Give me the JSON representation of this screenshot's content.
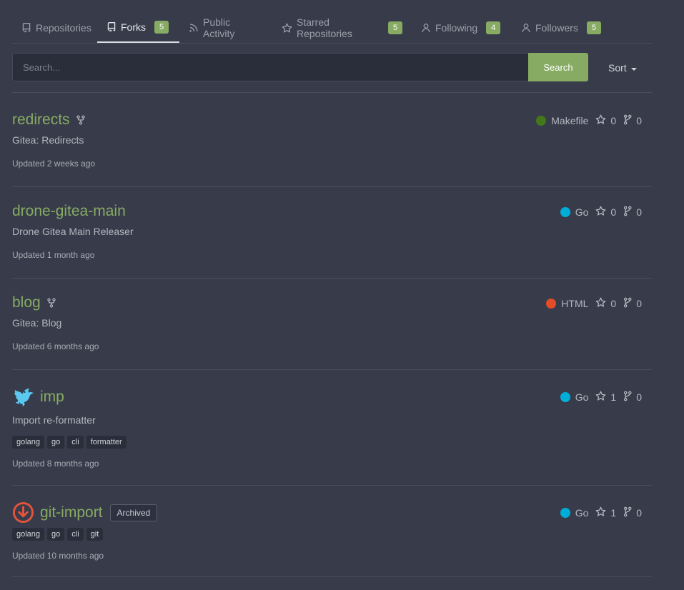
{
  "tabs": [
    {
      "label": "Repositories",
      "icon": "repo-icon"
    },
    {
      "label": "Forks",
      "icon": "repo-icon",
      "count": "5",
      "active": true
    },
    {
      "label": "Public Activity",
      "icon": "rss-icon"
    },
    {
      "label": "Starred Repositories",
      "icon": "star-icon",
      "count": "5"
    },
    {
      "label": "Following",
      "icon": "person-icon",
      "count": "4"
    },
    {
      "label": "Followers",
      "icon": "person-icon",
      "count": "5"
    }
  ],
  "search": {
    "placeholder": "Search...",
    "button_label": "Search"
  },
  "sort": {
    "label": "Sort"
  },
  "repos": [
    {
      "name": "redirects",
      "fork": true,
      "description": "Gitea: Redirects",
      "language": "Makefile",
      "lang_color": "#427819",
      "stars": "0",
      "forks": "0",
      "updated": "Updated 2 weeks ago"
    },
    {
      "name": "drone-gitea-main",
      "description": "Drone Gitea Main Releaser",
      "language": "Go",
      "lang_color": "#00add8",
      "stars": "0",
      "forks": "0",
      "updated": "Updated 1 month ago"
    },
    {
      "name": "blog",
      "fork": true,
      "description": "Gitea: Blog",
      "language": "HTML",
      "lang_color": "#e34c26",
      "stars": "0",
      "forks": "0",
      "updated": "Updated 6 months ago"
    },
    {
      "name": "imp",
      "avatar": "dragon-icon",
      "description": "Import re-formatter",
      "topics": [
        "golang",
        "go",
        "cli",
        "formatter"
      ],
      "language": "Go",
      "lang_color": "#00add8",
      "stars": "1",
      "forks": "0",
      "updated": "Updated 8 months ago"
    },
    {
      "name": "git-import",
      "avatar": "download-circle-icon",
      "archived_label": "Archived",
      "topics": [
        "golang",
        "go",
        "cli",
        "git"
      ],
      "language": "Go",
      "lang_color": "#00add8",
      "stars": "1",
      "forks": "0",
      "updated": "Updated 10 months ago"
    }
  ]
}
